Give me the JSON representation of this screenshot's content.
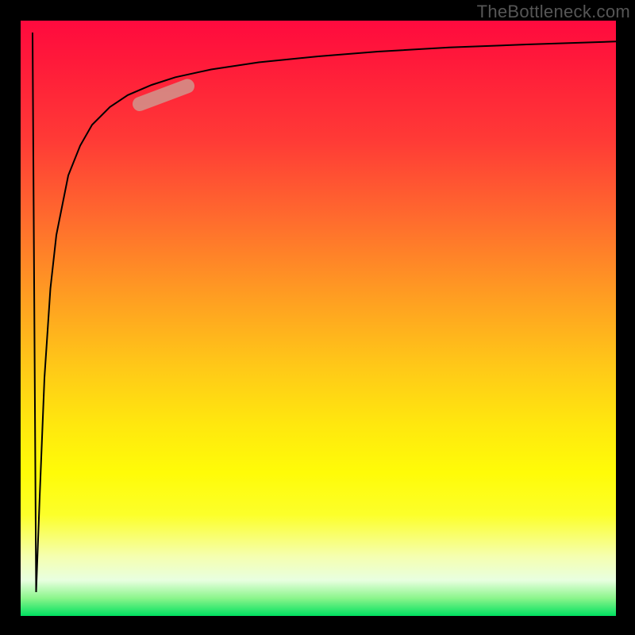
{
  "watermark": "TheBottleneck.com",
  "colors": {
    "frame": "#000000",
    "curve": "#000000",
    "marker": "#cf988f",
    "gradient_top": "#ff0a3e",
    "gradient_bottom": "#00e060"
  },
  "chart_data": {
    "type": "line",
    "title": "",
    "xlabel": "",
    "ylabel": "",
    "xlim": [
      0,
      100
    ],
    "ylim": [
      0,
      100
    ],
    "grid": false,
    "legend": false,
    "series": [
      {
        "name": "spike",
        "x": [
          2.0,
          2.6,
          3.2
        ],
        "values": [
          98,
          4,
          20
        ]
      },
      {
        "name": "curve",
        "x": [
          3.2,
          4,
          5,
          6,
          8,
          10,
          12,
          15,
          18,
          22,
          26,
          32,
          40,
          50,
          60,
          72,
          85,
          100
        ],
        "values": [
          20,
          40,
          55,
          64,
          74,
          79,
          82.5,
          85.5,
          87.5,
          89.2,
          90.5,
          91.8,
          93,
          94,
          94.8,
          95.5,
          96,
          96.5
        ]
      }
    ],
    "annotations": [
      {
        "name": "highlight-marker",
        "x_range": [
          20,
          28
        ],
        "y_range": [
          86,
          89
        ],
        "color": "#cf988f"
      }
    ],
    "background": {
      "type": "vertical-gradient",
      "description": "red at top through orange and yellow to green at bottom",
      "stops": [
        {
          "pos": 0.0,
          "color": "#ff0a3e"
        },
        {
          "pos": 0.5,
          "color": "#ffb018"
        },
        {
          "pos": 0.8,
          "color": "#fffc08"
        },
        {
          "pos": 1.0,
          "color": "#00e060"
        }
      ]
    }
  }
}
